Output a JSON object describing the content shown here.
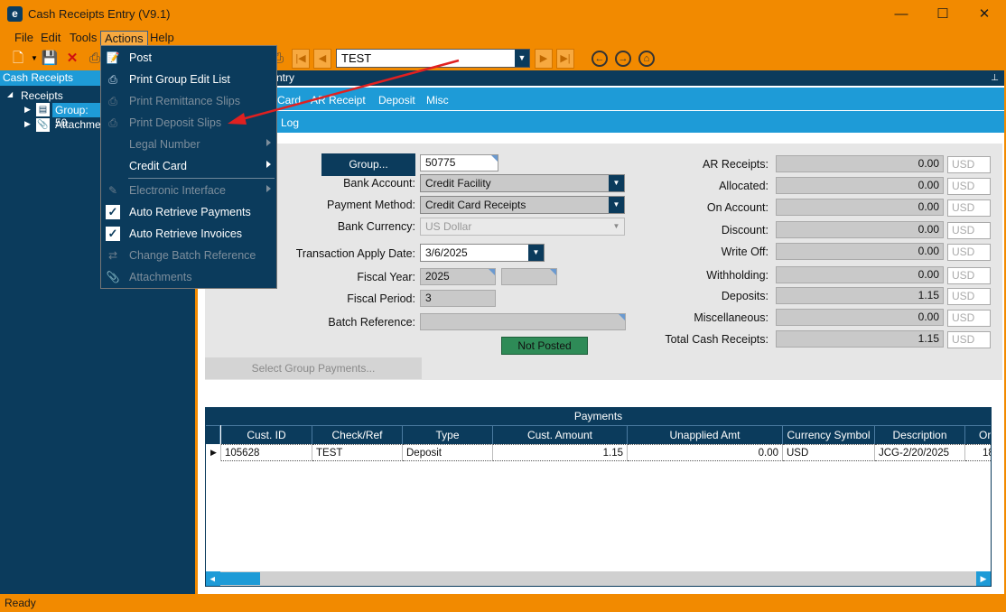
{
  "window": {
    "title": "Cash Receipts Entry (V9.1)",
    "app_icon": "e",
    "minimize": "—",
    "maximize": "☐",
    "close": "✕"
  },
  "menubar": [
    "File",
    "Edit",
    "Tools",
    "Actions",
    "Help"
  ],
  "toolbar": {
    "batch_value": "TEST"
  },
  "left_panel": {
    "header": "Cash Receipts",
    "tree": {
      "root": "Receipts",
      "group": "Group: 50",
      "attachments": "Attachme"
    }
  },
  "right_panel": {
    "header": "ntry",
    "tabs": [
      "Card",
      "AR Receipt",
      "Deposit",
      "Misc"
    ],
    "subtabs": [
      "Log"
    ]
  },
  "form": {
    "group_button": "Group...",
    "group_value": "50775",
    "bank_account_label": "Bank Account:",
    "bank_account_value": "Credit Facility",
    "payment_method_label": "Payment Method:",
    "payment_method_value": "Credit Card Receipts",
    "bank_currency_label": "Bank Currency:",
    "bank_currency_value": "US Dollar",
    "apply_date_label": "Transaction Apply Date:",
    "apply_date_value": "3/6/2025",
    "fiscal_year_label": "Fiscal Year:",
    "fiscal_year_value": "2025",
    "fiscal_period_label": "Fiscal Period:",
    "fiscal_period_value": "3",
    "batch_ref_label": "Batch Reference:",
    "status": "Not Posted",
    "select_group_payments": "Select Group Payments..."
  },
  "totals": [
    {
      "label": "AR Receipts:",
      "value": "0.00",
      "currency": "USD"
    },
    {
      "label": "Allocated:",
      "value": "0.00",
      "currency": "USD"
    },
    {
      "label": "On Account:",
      "value": "0.00",
      "currency": "USD"
    },
    {
      "label": "Discount:",
      "value": "0.00",
      "currency": "USD"
    },
    {
      "label": "Write Off:",
      "value": "0.00",
      "currency": "USD"
    },
    {
      "label": "Withholding:",
      "value": "0.00",
      "currency": "USD"
    },
    {
      "label": "Deposits:",
      "value": "1.15",
      "currency": "USD"
    },
    {
      "label": "Miscellaneous:",
      "value": "0.00",
      "currency": "USD"
    },
    {
      "label": "Total Cash Receipts:",
      "value": "1.15",
      "currency": "USD"
    }
  ],
  "payments": {
    "title": "Payments",
    "columns": [
      "Cust. ID",
      "Check/Ref",
      "Type",
      "Cust. Amount",
      "Unapplied Amt",
      "Currency Symbol",
      "Description",
      "Or"
    ],
    "rows": [
      [
        "105628",
        "TEST",
        "Deposit",
        "1.15",
        "0.00",
        "USD",
        "JCG-2/20/2025",
        "18"
      ]
    ]
  },
  "actions_menu": [
    {
      "label": "Post",
      "icon": "post-icon",
      "enabled": true
    },
    {
      "label": "Print Group Edit List",
      "icon": "print-list-icon",
      "enabled": true
    },
    {
      "label": "Print Remittance Slips",
      "icon": "print-remit-icon",
      "enabled": false
    },
    {
      "label": "Print Deposit Slips",
      "icon": "print-deposit-icon",
      "enabled": false
    },
    {
      "label": "Legal Number",
      "enabled": false,
      "submenu": true
    },
    {
      "label": "Credit Card",
      "enabled": true,
      "submenu": true
    },
    {
      "label": "Electronic Interface",
      "icon": "electronic-interface-icon",
      "enabled": false,
      "submenu": true
    },
    {
      "label": "Auto Retrieve Payments",
      "checked": true,
      "enabled": true
    },
    {
      "label": "Auto Retrieve Invoices",
      "checked": true,
      "enabled": true
    },
    {
      "label": "Change Batch Reference",
      "icon": "change-batch-icon",
      "enabled": false
    },
    {
      "label": "Attachments",
      "icon": "attachment-icon",
      "enabled": false
    }
  ],
  "statusbar": "Ready",
  "colors": {
    "accent_orange": "#f28a00",
    "navy": "#0b3b5c",
    "blue": "#1e9bd7",
    "status_green": "#2e8b57",
    "annotation_red": "#e02020"
  }
}
